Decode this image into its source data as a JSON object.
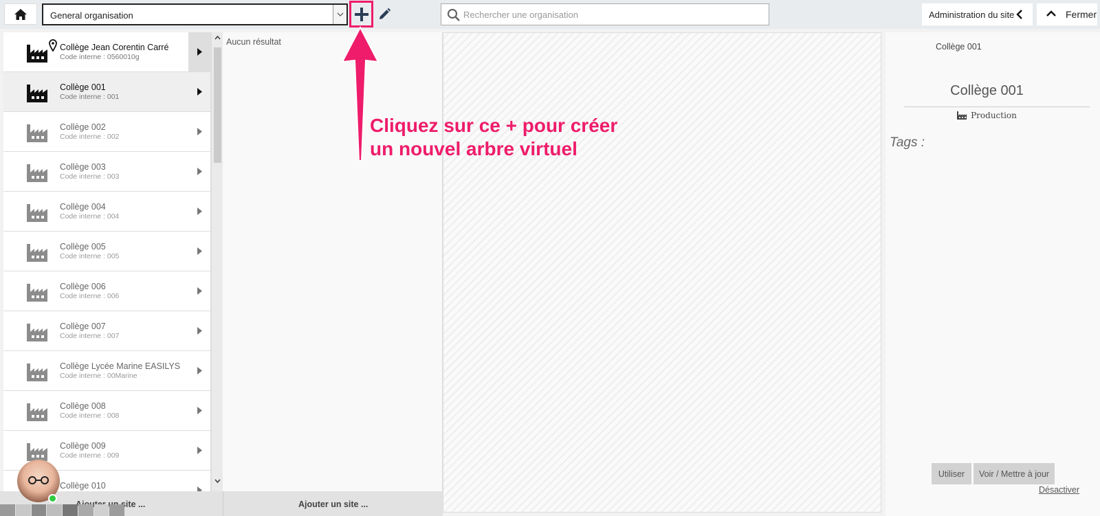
{
  "toolbar": {
    "org_select_value": "General organisation",
    "search_placeholder": "Rechercher une organisation",
    "admin_label": "Administration du site",
    "close_label": "Fermer"
  },
  "sites": [
    {
      "name": "Collège Jean Corentin Carré",
      "code": "Code interne : 0560010g"
    },
    {
      "name": "Collège 001",
      "code": "Code interne : 001"
    },
    {
      "name": "Collège 002",
      "code": "Code interne : 002"
    },
    {
      "name": "Collège 003",
      "code": "Code interne : 003"
    },
    {
      "name": "Collège 004",
      "code": "Code interne : 004"
    },
    {
      "name": "Collège 005",
      "code": "Code interne : 005"
    },
    {
      "name": "Collège 006",
      "code": "Code interne : 006"
    },
    {
      "name": "Collège 007",
      "code": "Code interne : 007"
    },
    {
      "name": "Collège Lycée Marine EASILYS",
      "code": "Code interne : 00Marine"
    },
    {
      "name": "Collège 008",
      "code": "Code interne : 008"
    },
    {
      "name": "Collège 009",
      "code": "Code interne : 009"
    },
    {
      "name": "Collège 010",
      "code": ""
    }
  ],
  "middle": {
    "no_result": "Aucun résultat"
  },
  "bottom": {
    "left_add_label": "Ajouter un site ...",
    "mid_add_label": "Ajouter un site ..."
  },
  "right_panel": {
    "breadcrumb": "Collège 001",
    "title": "Collège 001",
    "type": "Production",
    "tags_label": "Tags :",
    "use_button": "Utiliser",
    "update_button": "Voir / Mettre à jour",
    "deactivate_link": "Désactiver"
  },
  "annotation": {
    "line1": "Cliquez sur ce + pour créer",
    "line2": "un nouvel arbre virtuel",
    "color": "#ee1c6a"
  },
  "icons": {
    "home": "home-icon",
    "add": "plus-icon",
    "edit": "pencil-icon",
    "search": "search-icon",
    "factory": "factory-icon",
    "location": "map-pin-icon"
  }
}
